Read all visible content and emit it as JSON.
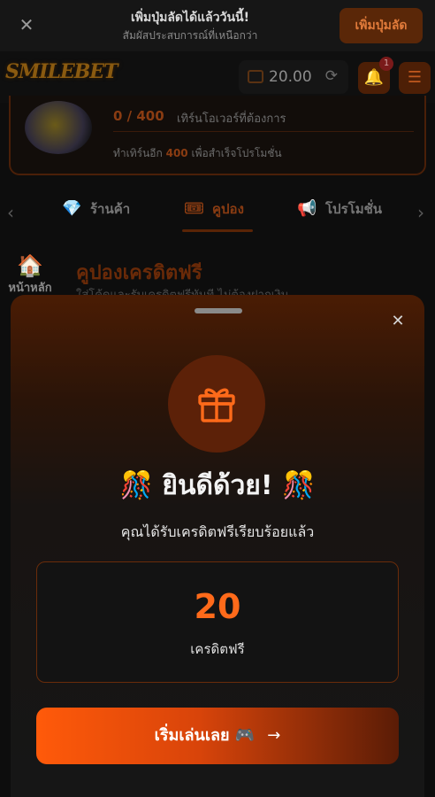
{
  "banner": {
    "title": "เพิ่มปุ่มลัดได้แล้ววันนี้!",
    "subtitle": "สัมผัสประสบการณ์ที่เหนือกว่า",
    "add_shortcut_label": "เพิ่มปุ่มลัด",
    "close_icon": "✕"
  },
  "header": {
    "logo_text": "SMILEBET",
    "balance": "20.00",
    "notification_count": "1",
    "bell_icon": "🔔",
    "menu_icon": "☰",
    "refresh_icon": "⟳"
  },
  "promo": {
    "progress": "0 / 400",
    "progress_label": "เทิร์นโอเวอร์ที่ต้องการ",
    "remaining_prefix": "ทำเทิร์นอีก",
    "remaining_amount": "400",
    "remaining_suffix": "เพื่อสำเร็จโปรโมชั่น"
  },
  "nav": {
    "left_arrow": "‹",
    "right_arrow": "›",
    "items": [
      {
        "icon": "💎",
        "label": "ร้านค้า"
      },
      {
        "icon": "🎟",
        "label": "คูปอง"
      },
      {
        "icon": "📢",
        "label": "โปรโมชั่น"
      }
    ]
  },
  "home": {
    "icon": "🏠",
    "label": "หน้าหลัก"
  },
  "page": {
    "title": "คูปองเครดิตฟรี",
    "subtitle": "ใส่โค้ดและรับเครดิตฟรีทันที ไม่ต้องฝากเงิน"
  },
  "modal": {
    "close_icon": "✕",
    "gift_icon": "gift-icon",
    "congrats": "🎊 ยินดีด้วย! 🎊",
    "message": "คุณได้รับเครดิตฟรีเรียบร้อยแล้ว",
    "credit_value": "20",
    "credit_label": "เครดิตฟรี",
    "play_label": "เริ่มเล่นเลย 🎮",
    "play_arrow": "→"
  },
  "colors": {
    "accent": "#ff6a1a",
    "button_start": "#ff5a0a",
    "background": "#0d0d0d"
  }
}
